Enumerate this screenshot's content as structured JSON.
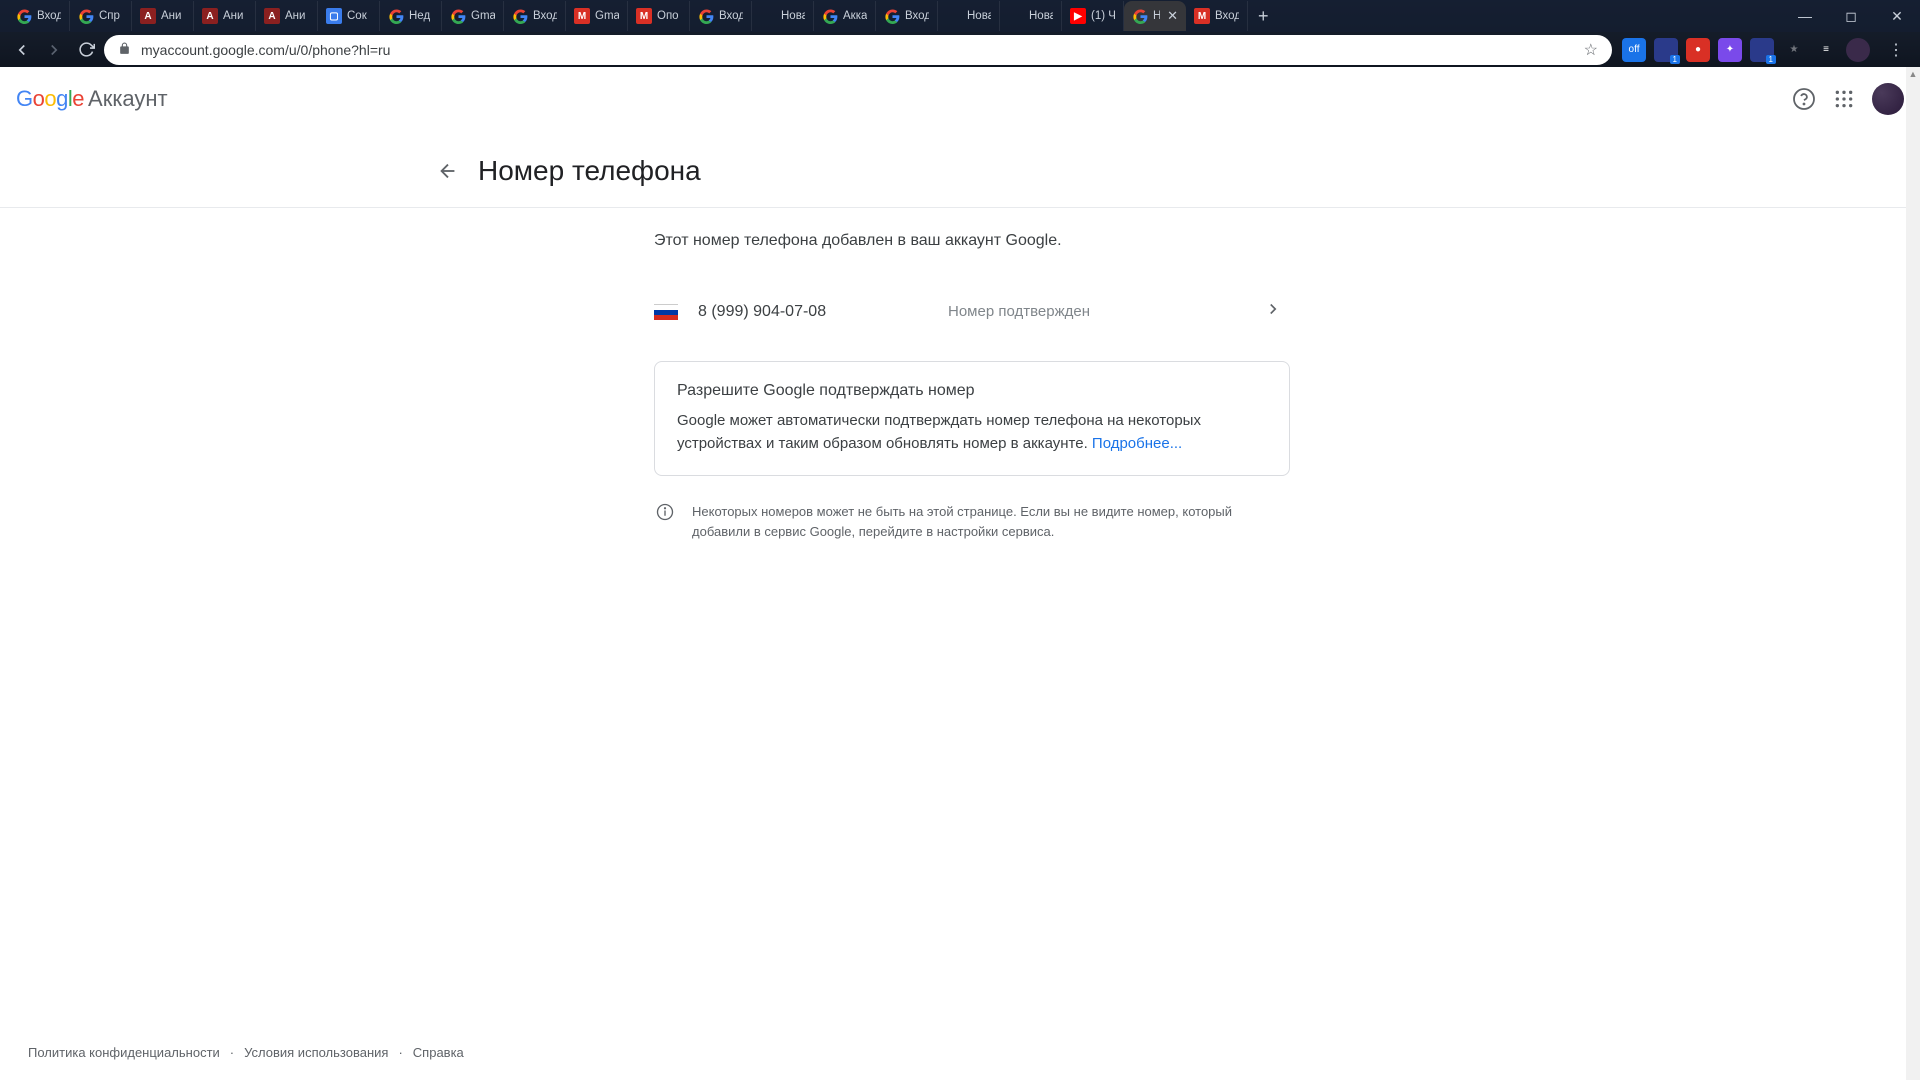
{
  "browser": {
    "tabs": [
      {
        "favicon": "G",
        "favcolor": "#fff",
        "favbg": "transparent",
        "title": "Вход"
      },
      {
        "favicon": "G",
        "favcolor": "#fff",
        "favbg": "transparent",
        "title": "Спр"
      },
      {
        "favicon": "A",
        "favcolor": "#fff",
        "favbg": "#8b2020",
        "title": "Ани"
      },
      {
        "favicon": "A",
        "favcolor": "#fff",
        "favbg": "#8b2020",
        "title": "Ани"
      },
      {
        "favicon": "A",
        "favcolor": "#fff",
        "favbg": "#8b2020",
        "title": "Ани"
      },
      {
        "favicon": "▢",
        "favcolor": "#fff",
        "favbg": "#3a7cec",
        "title": "Сок"
      },
      {
        "favicon": "G",
        "favcolor": "#fff",
        "favbg": "transparent",
        "title": "Нед"
      },
      {
        "favicon": "G",
        "favcolor": "#fff",
        "favbg": "transparent",
        "title": "Gma"
      },
      {
        "favicon": "G",
        "favcolor": "#fff",
        "favbg": "transparent",
        "title": "Вход"
      },
      {
        "favicon": "M",
        "favcolor": "#fff",
        "favbg": "#d93025",
        "title": "Gma"
      },
      {
        "favicon": "M",
        "favcolor": "#fff",
        "favbg": "#d93025",
        "title": "Опо"
      },
      {
        "favicon": "G",
        "favcolor": "#fff",
        "favbg": "transparent",
        "title": "Вход"
      },
      {
        "favicon": "",
        "favcolor": "#fff",
        "favbg": "transparent",
        "title": "Новая вк"
      },
      {
        "favicon": "G",
        "favcolor": "#fff",
        "favbg": "transparent",
        "title": "Акка"
      },
      {
        "favicon": "G",
        "favcolor": "#fff",
        "favbg": "transparent",
        "title": "Вход"
      },
      {
        "favicon": "",
        "favcolor": "#fff",
        "favbg": "transparent",
        "title": "Новая вк"
      },
      {
        "favicon": "",
        "favcolor": "#fff",
        "favbg": "transparent",
        "title": "Новая вк"
      },
      {
        "favicon": "▶",
        "favcolor": "#fff",
        "favbg": "#ff0000",
        "title": "(1) Ч"
      },
      {
        "favicon": "G",
        "favcolor": "#fff",
        "favbg": "transparent",
        "title": "Н",
        "active": true
      },
      {
        "favicon": "M",
        "favcolor": "#fff",
        "favbg": "#d93025",
        "title": "Вход"
      }
    ],
    "url": "myaccount.google.com/u/0/phone?hl=ru",
    "extensions": [
      {
        "label": "off",
        "bg": "#1a73e8"
      },
      {
        "label": "",
        "bg": "#2a3a8a",
        "badge": "1"
      },
      {
        "label": "●",
        "bg": "#d93025"
      },
      {
        "label": "✦",
        "bg": "#7a4aea"
      },
      {
        "label": "",
        "bg": "#2a3a8a",
        "badge": "1"
      },
      {
        "label": "★",
        "bg": "transparent",
        "dim": true
      },
      {
        "label": "≡",
        "bg": "transparent"
      },
      {
        "label": "",
        "bg": "#3a2a4a",
        "round": true
      }
    ]
  },
  "header": {
    "logo_account": "Аккаунт"
  },
  "page": {
    "title": "Номер телефона",
    "description": "Этот номер телефона добавлен в ваш аккаунт Google.",
    "phone": "8 (999) 904-07-08",
    "phone_status": "Номер подтвержден",
    "card_title": "Разрешите Google подтверждать номер",
    "card_body": "Google может автоматически подтверждать номер телефона на некоторых устройствах и таким образом обновлять номер в аккаунте. ",
    "card_link": "Подробнее...",
    "info_text": "Некоторых номеров может не быть на этой странице. Если вы не видите номер, который добавили в сервис Google, перейдите в настройки сервиса."
  },
  "footer": {
    "privacy": "Политика конфиденциальности",
    "terms": "Условия использования",
    "help": "Справка"
  }
}
